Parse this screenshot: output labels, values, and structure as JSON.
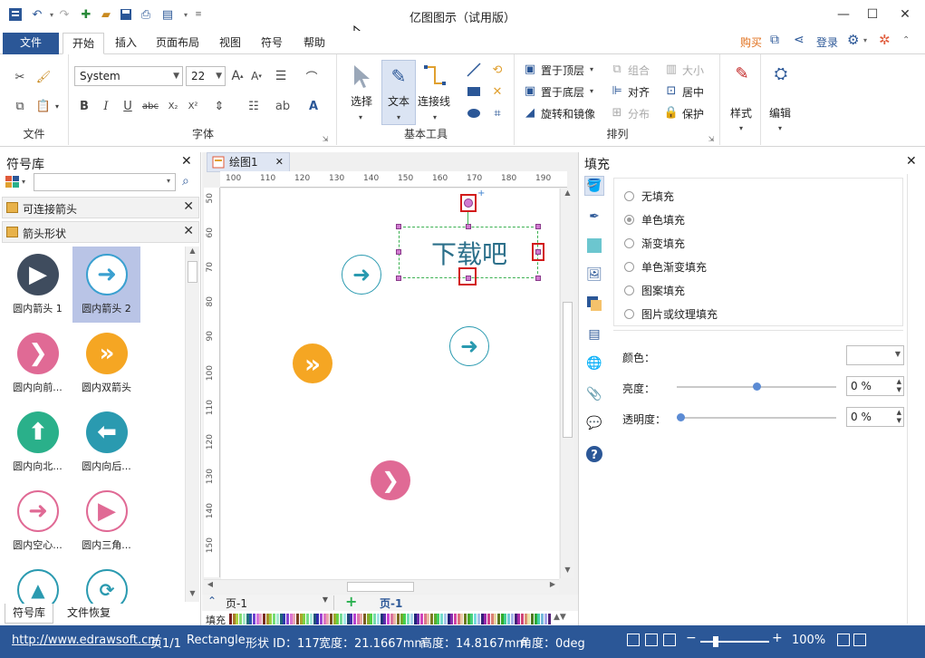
{
  "titlebar": {
    "title": "亿图图示（试用版）",
    "buttons": {
      "minimize": "—",
      "maximize": "☐",
      "close": "✕"
    }
  },
  "menu": {
    "file": "文件",
    "tabs": [
      "开始",
      "插入",
      "页面布局",
      "视图",
      "符号",
      "帮助"
    ],
    "right": {
      "buy": "购买",
      "login": "登录"
    }
  },
  "ribbon": {
    "file_group": {
      "label": "文件"
    },
    "font_group": {
      "label": "字体",
      "font_name": "System",
      "font_size": "22"
    },
    "basic_tools": {
      "label": "基本工具",
      "select": "选择",
      "text": "文本",
      "connector": "连接线"
    },
    "arrange": {
      "label": "排列",
      "bring_front": "置于顶层",
      "send_back": "置于底层",
      "rotate_mirror": "旋转和镜像",
      "group": "组合",
      "align": "对齐",
      "distribute": "分布",
      "size": "大小",
      "center": "居中",
      "protect": "保护"
    },
    "style": "样式",
    "edit": "编辑"
  },
  "library": {
    "title": "符号库",
    "search_value": "",
    "categories": [
      "可连接箭头",
      "箭头形状"
    ],
    "shapes": [
      {
        "label": "圆内箭头 1",
        "color": "#3f4c5e",
        "glyph": "▶",
        "selected": false
      },
      {
        "label": "圆内箭头 2",
        "color": "#3aa0d0",
        "glyph": "➜",
        "selected": true
      },
      {
        "label": "圆内向前...",
        "color": "#e06a95",
        "glyph": "❯",
        "selected": false
      },
      {
        "label": "圆内双箭头",
        "color": "#f5a623",
        "glyph": "»",
        "selected": false
      },
      {
        "label": "圆内向北...",
        "color": "#2ab08a",
        "glyph": "⬆",
        "selected": false
      },
      {
        "label": "圆内向后...",
        "color": "#2a9ab0",
        "glyph": "⬅",
        "selected": false
      },
      {
        "label": "圆内空心...",
        "color": "#e06a95",
        "glyph": "➜",
        "selected": false
      },
      {
        "label": "圆内三角...",
        "color": "#e06a95",
        "glyph": "▶",
        "selected": false
      }
    ],
    "bottom_tabs": [
      "符号库",
      "文件恢复"
    ]
  },
  "canvas": {
    "doc_tab": "绘图1",
    "ruler_h": [
      "100",
      "110",
      "120",
      "130",
      "140",
      "150",
      "160",
      "170",
      "180",
      "190"
    ],
    "ruler_v": [
      "50",
      "60",
      "70",
      "80",
      "90",
      "100",
      "110",
      "120",
      "130",
      "140",
      "150"
    ],
    "textbox": "下载吧",
    "page_select": "页-1",
    "page_tab": "页-1",
    "fill_label": "填充"
  },
  "fill_panel": {
    "title": "填充",
    "options": [
      "无填充",
      "单色填充",
      "渐变填充",
      "单色渐变填充",
      "图案填充",
      "图片或纹理填充"
    ],
    "selected_index": 1,
    "color_label": "颜色：",
    "brightness_label": "亮度：",
    "brightness_value": "0 %",
    "transparency_label": "透明度：",
    "transparency_value": "0 %"
  },
  "status": {
    "url": "http://www.edrawsoft.cn/",
    "page": "页1/1",
    "shape": "Rectangle",
    "shape_id": "形状 ID：117",
    "width": "宽度：21.1667mm",
    "height": "高度：14.8167mm",
    "angle": "角度：0deg",
    "zoom": "100%"
  },
  "colors": {
    "accent": "#2b5797",
    "buy": "#e0701d",
    "selected_shape": "#b9c4e6"
  }
}
